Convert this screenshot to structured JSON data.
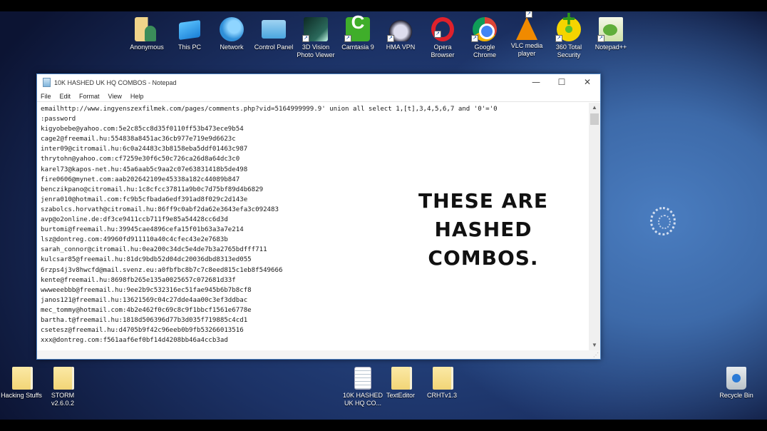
{
  "desktop": {
    "top_icons": [
      {
        "label": "Anonymous",
        "icon": "user-folder-icon",
        "cls": "ico-anonymous",
        "shortcut": false
      },
      {
        "label": "This PC",
        "icon": "computer-icon",
        "cls": "ico-thispc",
        "shortcut": false
      },
      {
        "label": "Network",
        "icon": "network-icon",
        "cls": "ico-network",
        "shortcut": false
      },
      {
        "label": "Control Panel",
        "icon": "control-panel-icon",
        "cls": "ico-control",
        "shortcut": false
      },
      {
        "label": "3D Vision Photo Viewer",
        "icon": "3d-vision-icon",
        "cls": "ico-3dvision",
        "shortcut": true
      },
      {
        "label": "Camtasia 9",
        "icon": "camtasia-icon",
        "cls": "ico-camtasia",
        "shortcut": true
      },
      {
        "label": "HMA VPN",
        "icon": "hma-vpn-icon",
        "cls": "ico-hma",
        "shortcut": true
      },
      {
        "label": "Opera Browser",
        "icon": "opera-icon",
        "cls": "ico-opera",
        "shortcut": true
      },
      {
        "label": "Google Chrome",
        "icon": "chrome-icon",
        "cls": "ico-chrome",
        "shortcut": true
      },
      {
        "label": "VLC media player",
        "icon": "vlc-icon",
        "cls": "ico-vlc",
        "shortcut": true
      },
      {
        "label": "360 Total Security",
        "icon": "360-security-icon",
        "cls": "ico-360",
        "shortcut": true
      },
      {
        "label": "Notepad++",
        "icon": "notepad-plus-plus-icon",
        "cls": "ico-npp",
        "shortcut": true
      }
    ],
    "bottom_icons": [
      {
        "label": "Hacking Stuffs",
        "icon": "folder-icon",
        "cls": "ico-folder"
      },
      {
        "label": "STORM v2.6.0.2",
        "icon": "folder-icon",
        "cls": "ico-folder"
      },
      {
        "label": "10K HASHED UK HQ CO...",
        "icon": "text-file-icon",
        "cls": "ico-textfile"
      },
      {
        "label": "TextEditor",
        "icon": "folder-icon",
        "cls": "ico-folder"
      },
      {
        "label": "CRHTv1.3",
        "icon": "folder-icon",
        "cls": "ico-folder"
      },
      {
        "label": "Recycle Bin",
        "icon": "recycle-bin-icon",
        "cls": "ico-recycle"
      }
    ]
  },
  "notepad": {
    "title": "10K HASHED  UK HQ COMBOS - Notepad",
    "window_buttons": {
      "minimize": "—",
      "maximize": "☐",
      "close": "✕"
    },
    "menu": [
      "File",
      "Edit",
      "Format",
      "View",
      "Help"
    ],
    "lines": [
      "emailhttp://www.ingyenszexfilmek.com/pages/comments.php?vid=5164999999.9' union all select 1,[t],3,4,5,6,7 and '0'='0",
      ":password",
      "kigyobebe@yahoo.com:5e2c85cc8d35f0110ff53b473ece9b54",
      "cage2@freemail.hu:554838a8451ac36cb977e719e9d6623c",
      "inter09@citromail.hu:6c0a24483c3b8158eba5ddf01463c987",
      "thrytohn@yahoo.com:cf7259e30f6c50c726ca26d8a64dc3c0",
      "karel73@kapos-net.hu:45a6aab5c9aa2c07e63831418b5de498",
      "fire0606@mynet.com:aab202642109e45338a182c44089b847",
      "benczikpano@citromail.hu:1c8cfcc37811a9b0c7d75bf89d4b6829",
      "jenra010@hotmail.com:fc9b5cfbada6edf391ad8f029c2d143e",
      "szabolcs.horvath@citromail.hu:86ff9c0abf2da62e3643efa3c092483",
      "avp@o2online.de:df3ce9411ccb711f9e85a54428cc6d3d",
      "burtomi@freemail.hu:39945cae4896cefa15f01b63a3a7e214",
      "lsz@dontreg.com:49960fd911110a40c4cfec43e2e7683b",
      "sarah_connor@citromail.hu:0ea200c34dc5e4de7b3a2765bdfff711",
      "kulcsar85@freemail.hu:81dc9bdb52d04dc20036dbd8313ed055",
      "6rzps4j3v8hwcfd@mail.svenz.eu:a0fbfbc8b7c7c8eed815c1eb8f549666",
      "kente@freemail.hu:8698fb265e135a0025657c072681d33f",
      "wwweeebbb@freemail.hu:9ee2b9c532316ec51fae945b6b7b8cf8",
      "janos121@freemail.hu:13621569c04c27dde4aa00c3ef3ddbac",
      "mec_tommy@hotmail.com:4b2e462f0c69c8c9f1bbcf1561e6778e",
      "bartha.t@freemail.hu:1818d506396d77b3d035f719885c4cd1",
      "csetesz@freemail.hu:d4705b9f42c96eeb0b9fb53266013516",
      "xxx@dontreg.com:f561aaf6ef0bf14d4208bb46a4ccb3ad"
    ],
    "scroll": {
      "up": "▲",
      "down": "▼",
      "grip": "⋰"
    }
  },
  "caption": {
    "lines": [
      "THESE ARE",
      "HASHED",
      "COMBOS."
    ]
  }
}
